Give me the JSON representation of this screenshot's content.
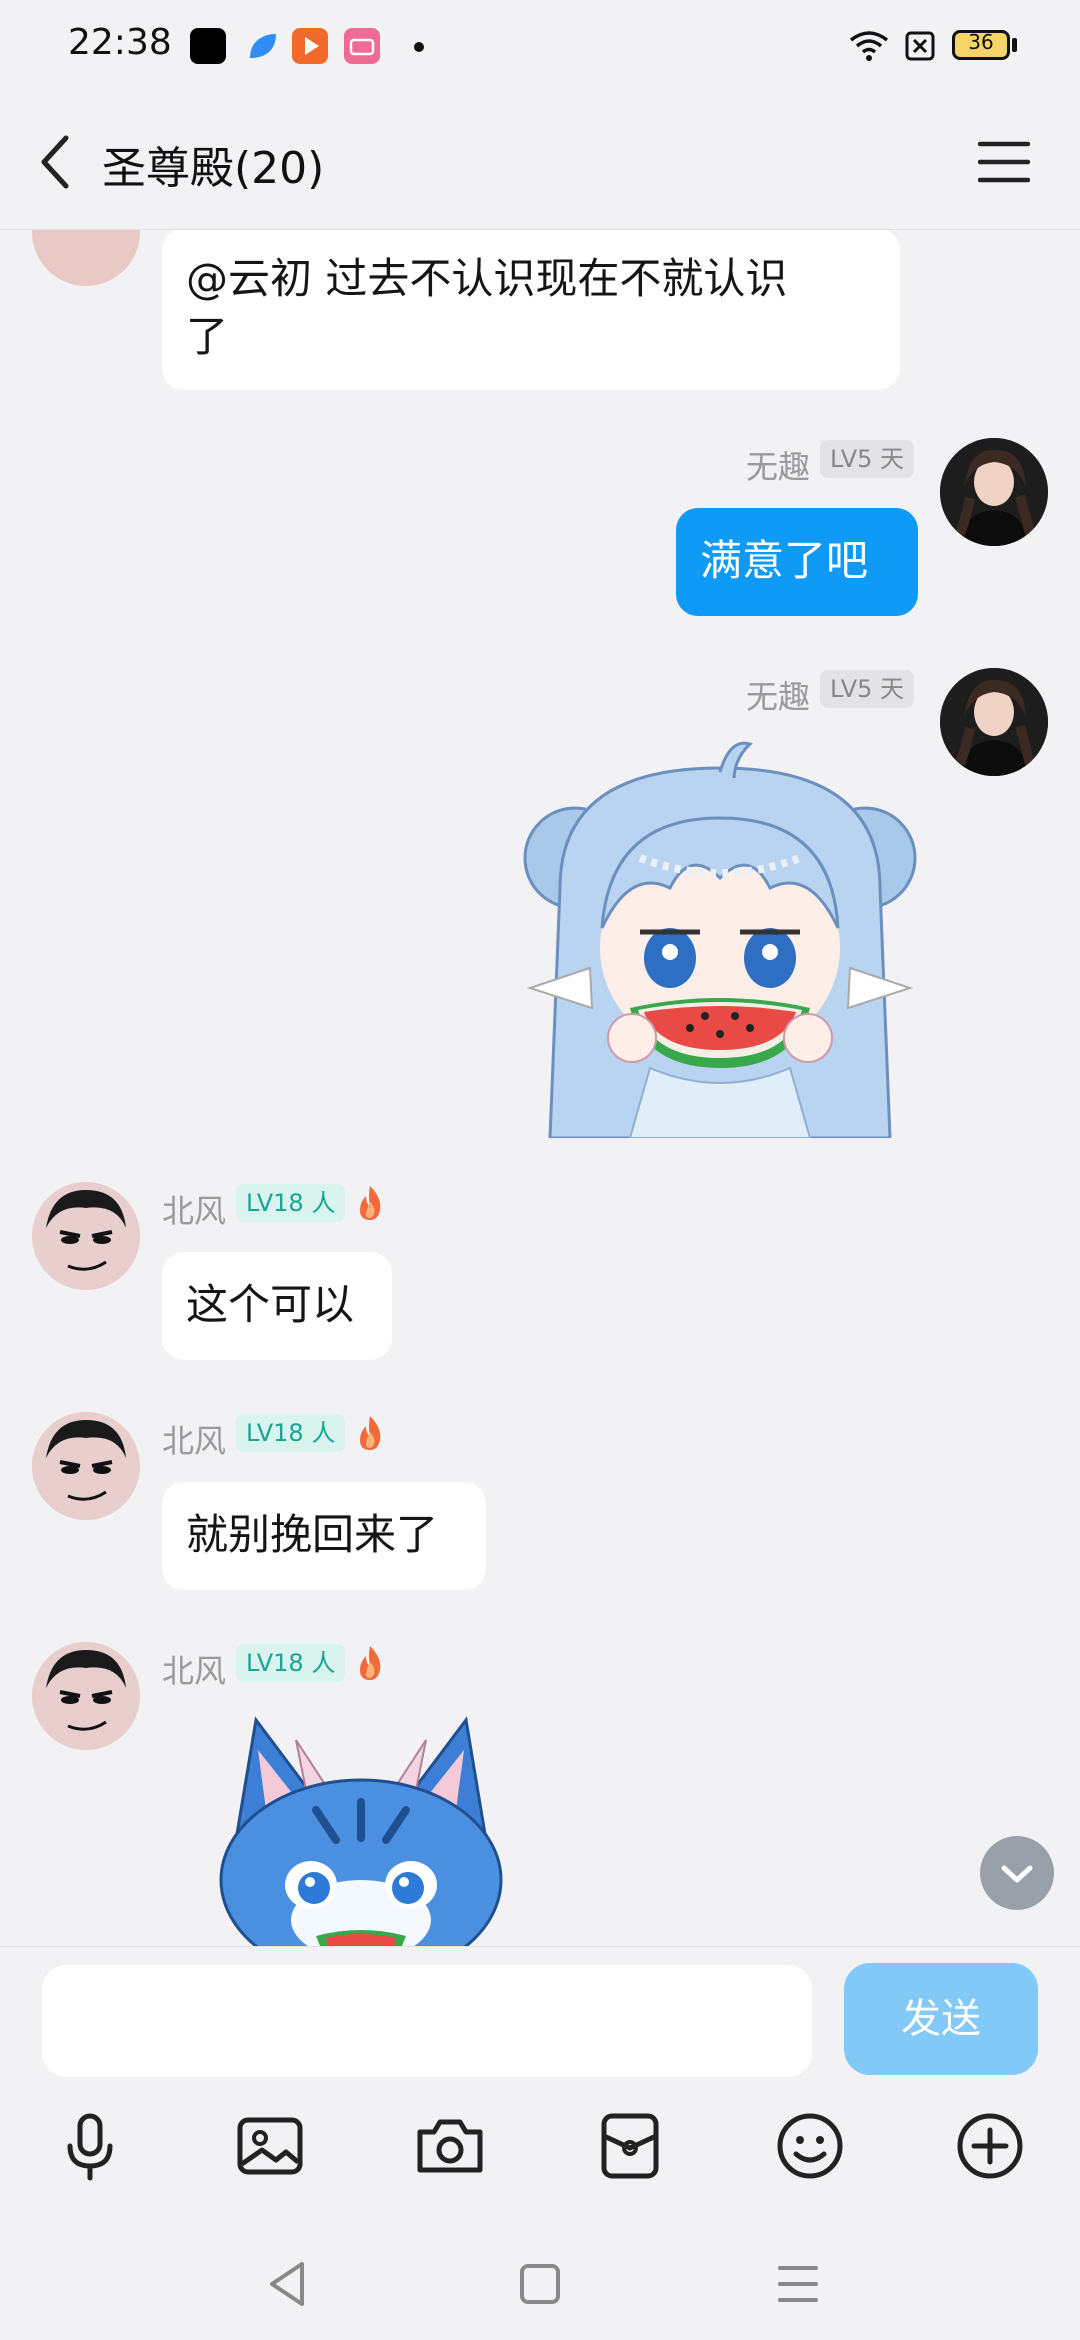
{
  "status_bar": {
    "time": "22:38",
    "battery": "36",
    "icons": [
      "app-black-icon",
      "app-blue-leaf-icon",
      "app-orange-play-icon",
      "app-pink-bilibili-icon",
      "dot-icon",
      "wifi-icon",
      "sim-x-icon",
      "battery-icon"
    ]
  },
  "header": {
    "back_icon": "chevron-left-icon",
    "title": "圣尊殿(20)",
    "menu_icon": "hamburger-icon"
  },
  "messages": [
    {
      "id": "m1",
      "side": "left",
      "type": "text",
      "text_line1": "@云初 过去不认识现在不就认识",
      "text_line2": "了"
    },
    {
      "id": "m2",
      "side": "right",
      "type": "text",
      "sender": "无趣",
      "level": "LV5 天",
      "text": "满意了吧"
    },
    {
      "id": "m3",
      "side": "right",
      "type": "sticker",
      "sender": "无趣",
      "level": "LV5 天",
      "sticker": "anime-girl-eating-watermelon"
    },
    {
      "id": "m4",
      "side": "left",
      "type": "text",
      "sender": "北风",
      "level": "LV18 人",
      "text": "这个可以"
    },
    {
      "id": "m5",
      "side": "left",
      "type": "text",
      "sender": "北风",
      "level": "LV18 人",
      "text": "就别挽回来了"
    },
    {
      "id": "m6",
      "side": "left",
      "type": "sticker",
      "sender": "北风",
      "level": "LV18 人",
      "sticker": "blue-tiger-cat"
    }
  ],
  "input": {
    "value": "",
    "placeholder": "",
    "send_label": "发送"
  },
  "toolbar": [
    "microphone-icon",
    "image-icon",
    "camera-icon",
    "red-packet-icon",
    "emoji-icon",
    "plus-icon"
  ],
  "colors": {
    "background": "#f2f2f4",
    "accent": "#0f9bf5",
    "send_disabled": "#82c9f7",
    "level_teal": "#17a693"
  }
}
